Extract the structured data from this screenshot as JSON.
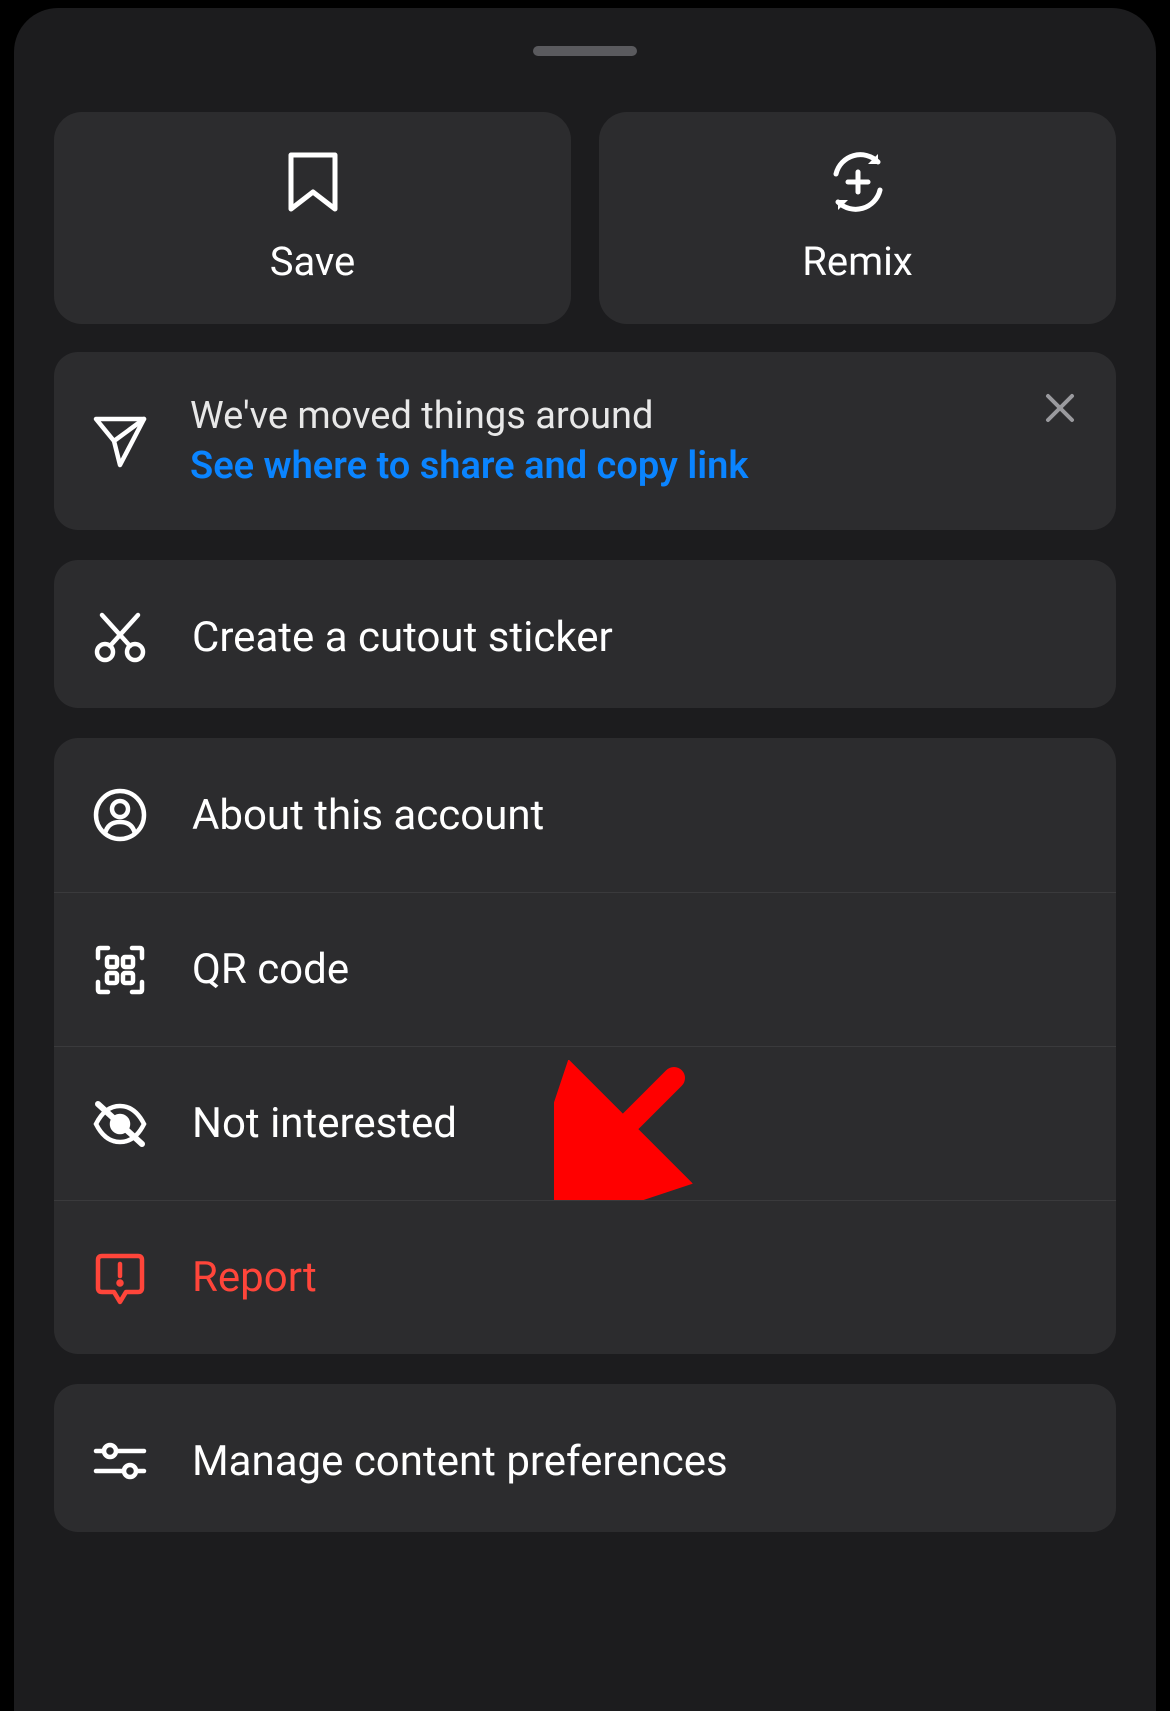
{
  "primary": {
    "save": "Save",
    "remix": "Remix"
  },
  "banner": {
    "line1": "We've moved things around",
    "line2": "See where to share and copy link"
  },
  "menu": {
    "cutout": "Create a cutout sticker",
    "about": "About this account",
    "qr": "QR code",
    "not_interested": "Not interested",
    "report": "Report",
    "manage_prefs": "Manage content preferences"
  },
  "colors": {
    "link": "#0a84ff",
    "danger": "#ff453a"
  }
}
